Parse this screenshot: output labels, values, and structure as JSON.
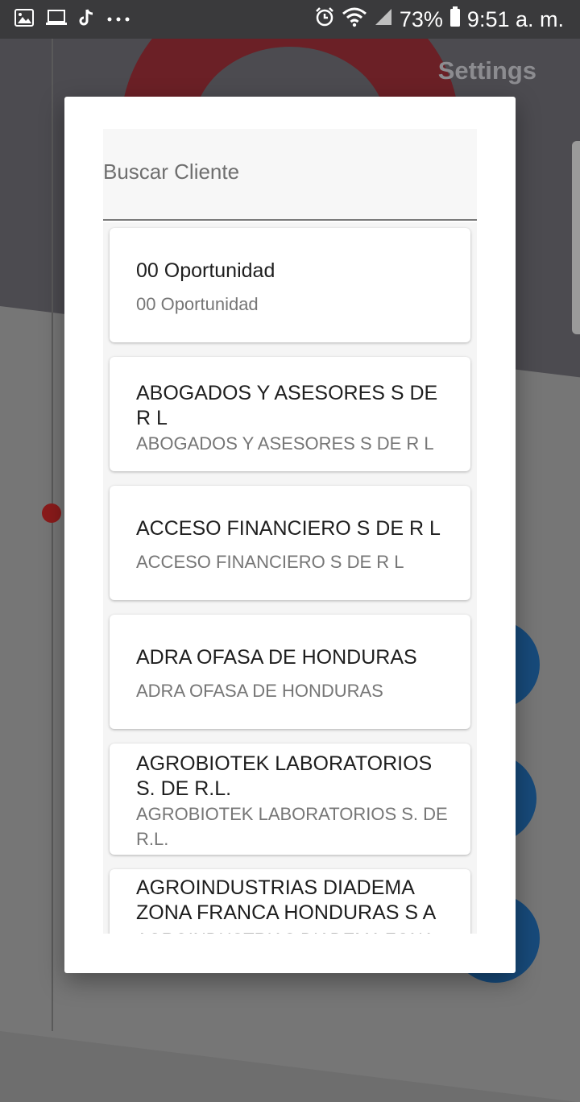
{
  "status_bar": {
    "icons_left": [
      "image-icon",
      "laptop-icon",
      "tiktok-icon",
      "more-dots-icon"
    ],
    "icons_right": [
      "alarm-icon",
      "wifi-icon",
      "signal-icon",
      "battery-icon"
    ],
    "battery": "73%",
    "time": "9:51 a. m."
  },
  "background": {
    "settings_label": "Settings"
  },
  "dialog": {
    "search": {
      "placeholder": "Buscar Cliente",
      "value": ""
    },
    "clients": [
      {
        "name": "00 Oportunidad",
        "subtitle": "00 Oportunidad"
      },
      {
        "name": "ABOGADOS Y ASESORES S DE R L",
        "subtitle": "ABOGADOS Y ASESORES S DE R L"
      },
      {
        "name": "ACCESO FINANCIERO S DE R L",
        "subtitle": "ACCESO FINANCIERO S DE R L"
      },
      {
        "name": "ADRA OFASA DE HONDURAS",
        "subtitle": "ADRA OFASA DE HONDURAS"
      },
      {
        "name": "AGROBIOTEK LABORATORIOS S. DE R.L.",
        "subtitle": "AGROBIOTEK LABORATORIOS S. DE R.L."
      },
      {
        "name": "AGROINDUSTRIAS DIADEMA ZONA FRANCA HONDURAS S A",
        "subtitle": "AGROINDUSTRIAS DIADEMA ZONA FRANCA HONDURAS S A"
      }
    ]
  }
}
